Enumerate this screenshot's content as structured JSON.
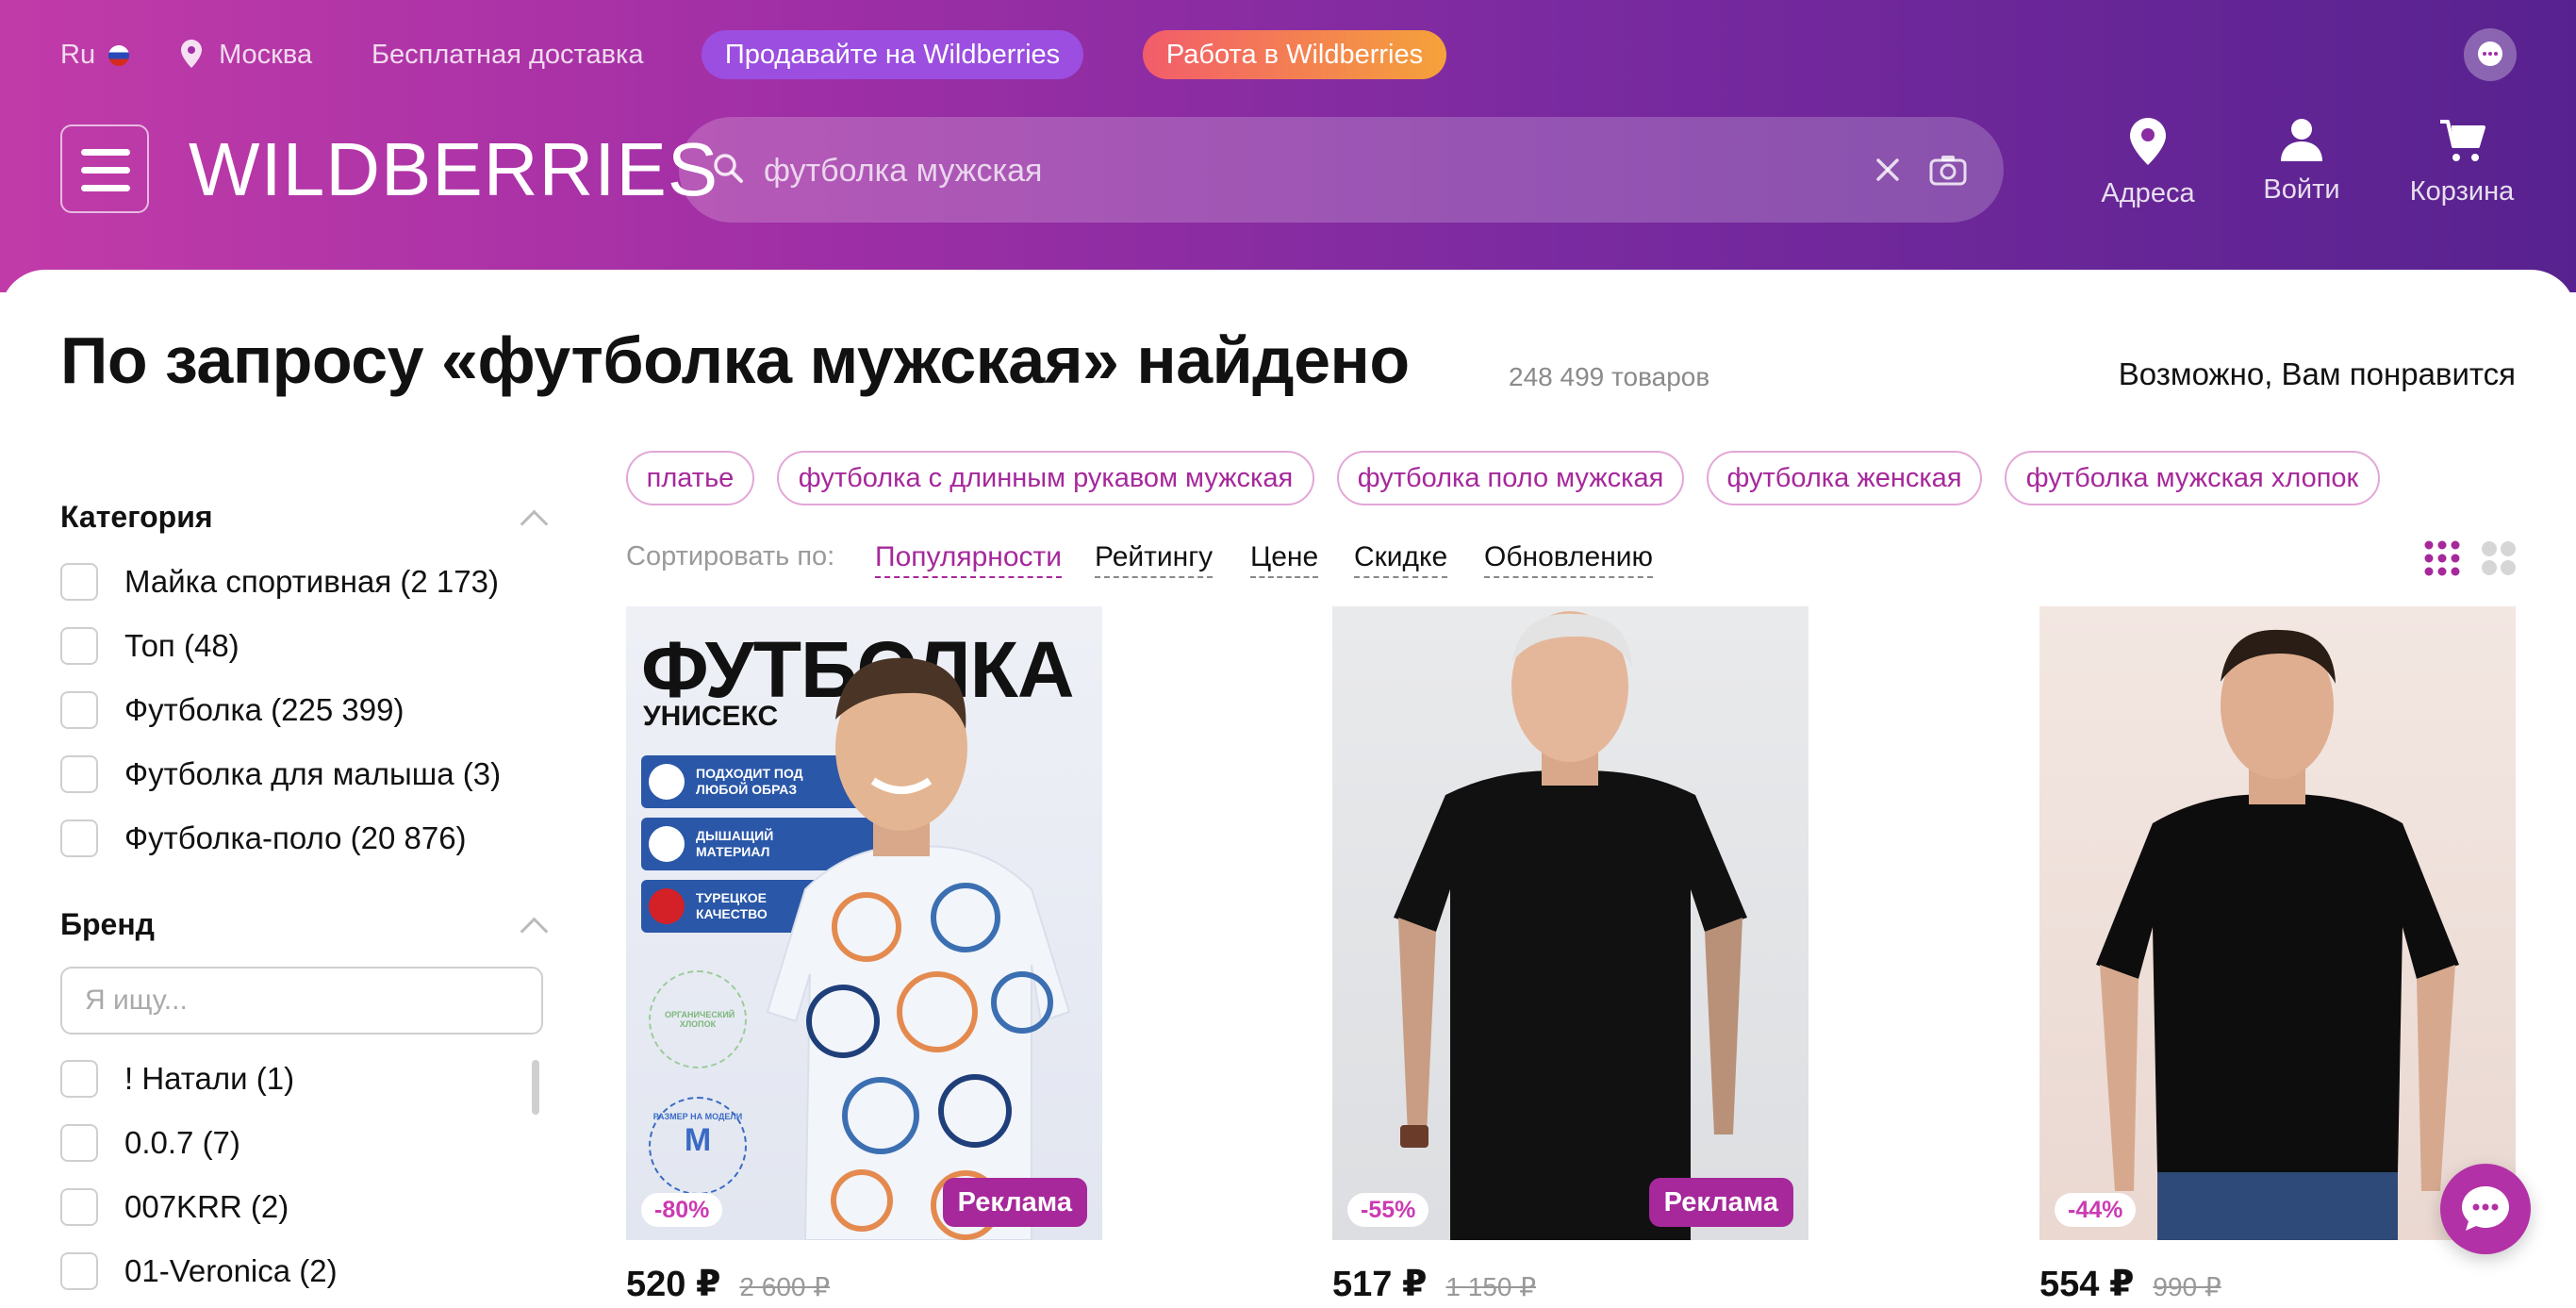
{
  "topbar": {
    "lang": "Ru",
    "city": "Москва",
    "delivery": "Бесплатная доставка",
    "sell_button": "Продавайте на Wildberries",
    "work_button": "Работа в Wildberries"
  },
  "header": {
    "logo": "WILDBERRIES",
    "search_value": "футболка мужская",
    "icons": [
      {
        "label": "Адреса",
        "icon": "map-pin-icon"
      },
      {
        "label": "Войти",
        "icon": "user-icon"
      },
      {
        "label": "Корзина",
        "icon": "cart-icon"
      }
    ]
  },
  "results": {
    "title": "По запросу «футболка мужская» найдено",
    "count": "248 499 товаров",
    "recommend": "Возможно, Вам понравится"
  },
  "filters": {
    "category": {
      "title": "Категория",
      "items": [
        "Майка спортивная (2 173)",
        "Топ (48)",
        "Футболка (225 399)",
        "Футболка для малыша (3)",
        "Футболка-поло (20 876)"
      ]
    },
    "brand": {
      "title": "Бренд",
      "search_placeholder": "Я ищу...",
      "items": [
        "! Натали (1)",
        "0.0.7 (7)",
        "007KRR (2)",
        "01-Veronica (2)"
      ]
    }
  },
  "chips": [
    "платье",
    "футболка с длинным рукавом мужская",
    "футболка поло мужская",
    "футболка женская",
    "футболка мужская хлопок"
  ],
  "sort": {
    "label": "Сортировать по:",
    "options": [
      "Популярности",
      "Рейтингу",
      "Цене",
      "Скидке",
      "Обновлению"
    ],
    "active": "Популярности"
  },
  "products": [
    {
      "discount": "-80%",
      "ad": "Реклама",
      "price": "520 ₽",
      "old_price": "2 600 ₽",
      "image": {
        "title": "ФУТБОЛКА",
        "subtitle": "УНИСЕКС",
        "features": [
          "ПОДХОДИТ ПОД ЛЮБОЙ ОБРАЗ",
          "ДЫШАЩИЙ МАТЕРИАЛ",
          "ТУРЕЦКОЕ КАЧЕСТВО"
        ],
        "organic": "ОРГАНИЧЕСКИЙ ХЛОПОК",
        "size_note": "РАЗМЕР НА МОДЕЛИ",
        "size": "M"
      }
    },
    {
      "discount": "-55%",
      "ad": "Реклама",
      "price": "517 ₽",
      "old_price": "1 150 ₽"
    },
    {
      "discount": "-44%",
      "ad": "",
      "price": "554 ₽",
      "old_price": "990 ₽"
    }
  ],
  "colors": {
    "accent": "#a6289b",
    "header_start": "#c13ba8",
    "header_end": "#57228f",
    "work_pill": "#f26e5b"
  }
}
